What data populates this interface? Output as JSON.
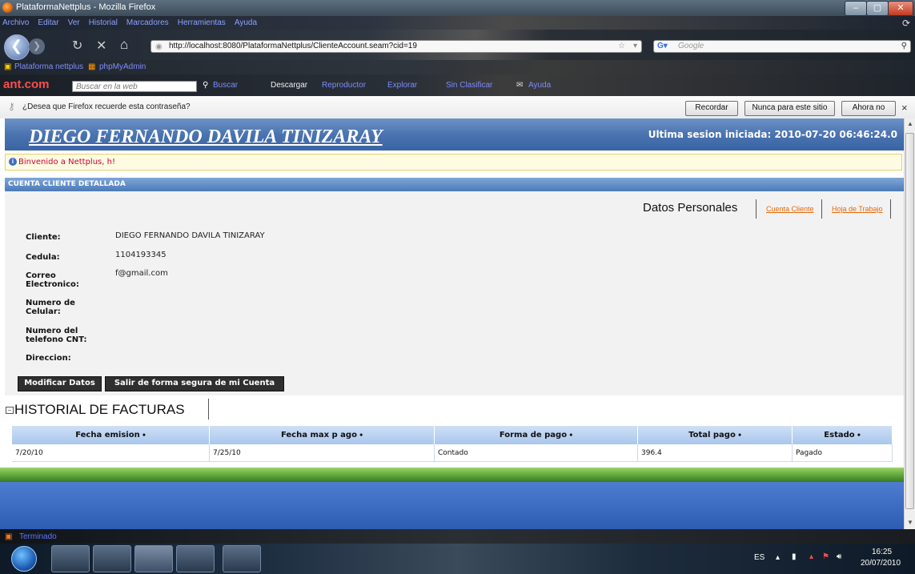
{
  "window": {
    "title": "PlataformaNettplus - Mozilla Firefox",
    "controls": [
      "–",
      "▢",
      "✕"
    ]
  },
  "menu": [
    "Archivo",
    "Editar",
    "Ver",
    "Historial",
    "Marcadores",
    "Herramientas",
    "Ayuda"
  ],
  "navigation": {
    "url": "http://localhost:8080/PlataformaNettplus/ClienteAccount.seam?cid=19",
    "search_placeholder": "Google"
  },
  "bookmarks": [
    "Plataforma nettplus",
    "phpMyAdmin"
  ],
  "antbar": {
    "logo": "ant.com",
    "search_placeholder": "Buscar en la web",
    "items": [
      "Buscar",
      "Descargar",
      "Reproductor",
      "Explorar",
      "Sin Clasificar",
      "Ayuda"
    ]
  },
  "password_prompt": {
    "message": "¿Desea que Firefox recuerde esta contraseña?",
    "remember": "Recordar",
    "never": "Nunca para este sitio",
    "not_now": "Ahora no",
    "close": "×"
  },
  "page": {
    "user_name": "DIEGO FERNANDO DAVILA TINIZARAY",
    "last_session": "Ultima sesion iniciada: 2010-07-20 06:46:24.0",
    "welcome": "Binvenido a Nettplus, h!",
    "section_title": "CUENTA CLIENTE DETALLADA",
    "tabs": {
      "active": "Datos Personales",
      "cuenta": "Cuenta Cliente",
      "hoja": "Hoja de Trabajo"
    },
    "fields": [
      {
        "label": "Cliente:",
        "value": "DIEGO FERNANDO DAVILA TINIZARAY"
      },
      {
        "label": "Cedula:",
        "value": "1104193345"
      },
      {
        "label": "Correo Electronico:",
        "value": "f@gmail.com"
      },
      {
        "label": "Numero de Celular:",
        "value": ""
      },
      {
        "label": "Numero del telefono CNT:",
        "value": ""
      },
      {
        "label": "Direccion:",
        "value": ""
      }
    ],
    "buttons": {
      "modify": "Modificar Datos",
      "logout": "Salir de forma segura de mi Cuenta"
    },
    "history": {
      "title": "HISTORIAL DE FACTURAS",
      "columns": [
        "Fecha emision ⬩",
        "Fecha max p ago ⬩",
        "Forma de pago ⬩",
        "Total pago ⬩",
        "Estado ⬩"
      ],
      "rows": [
        [
          "7/20/10",
          "7/25/10",
          "Contado",
          "396.4",
          "Pagado"
        ]
      ]
    }
  },
  "status": "Terminado",
  "tray": {
    "lang": "ES",
    "time": "16:25",
    "date": "20/07/2010"
  }
}
